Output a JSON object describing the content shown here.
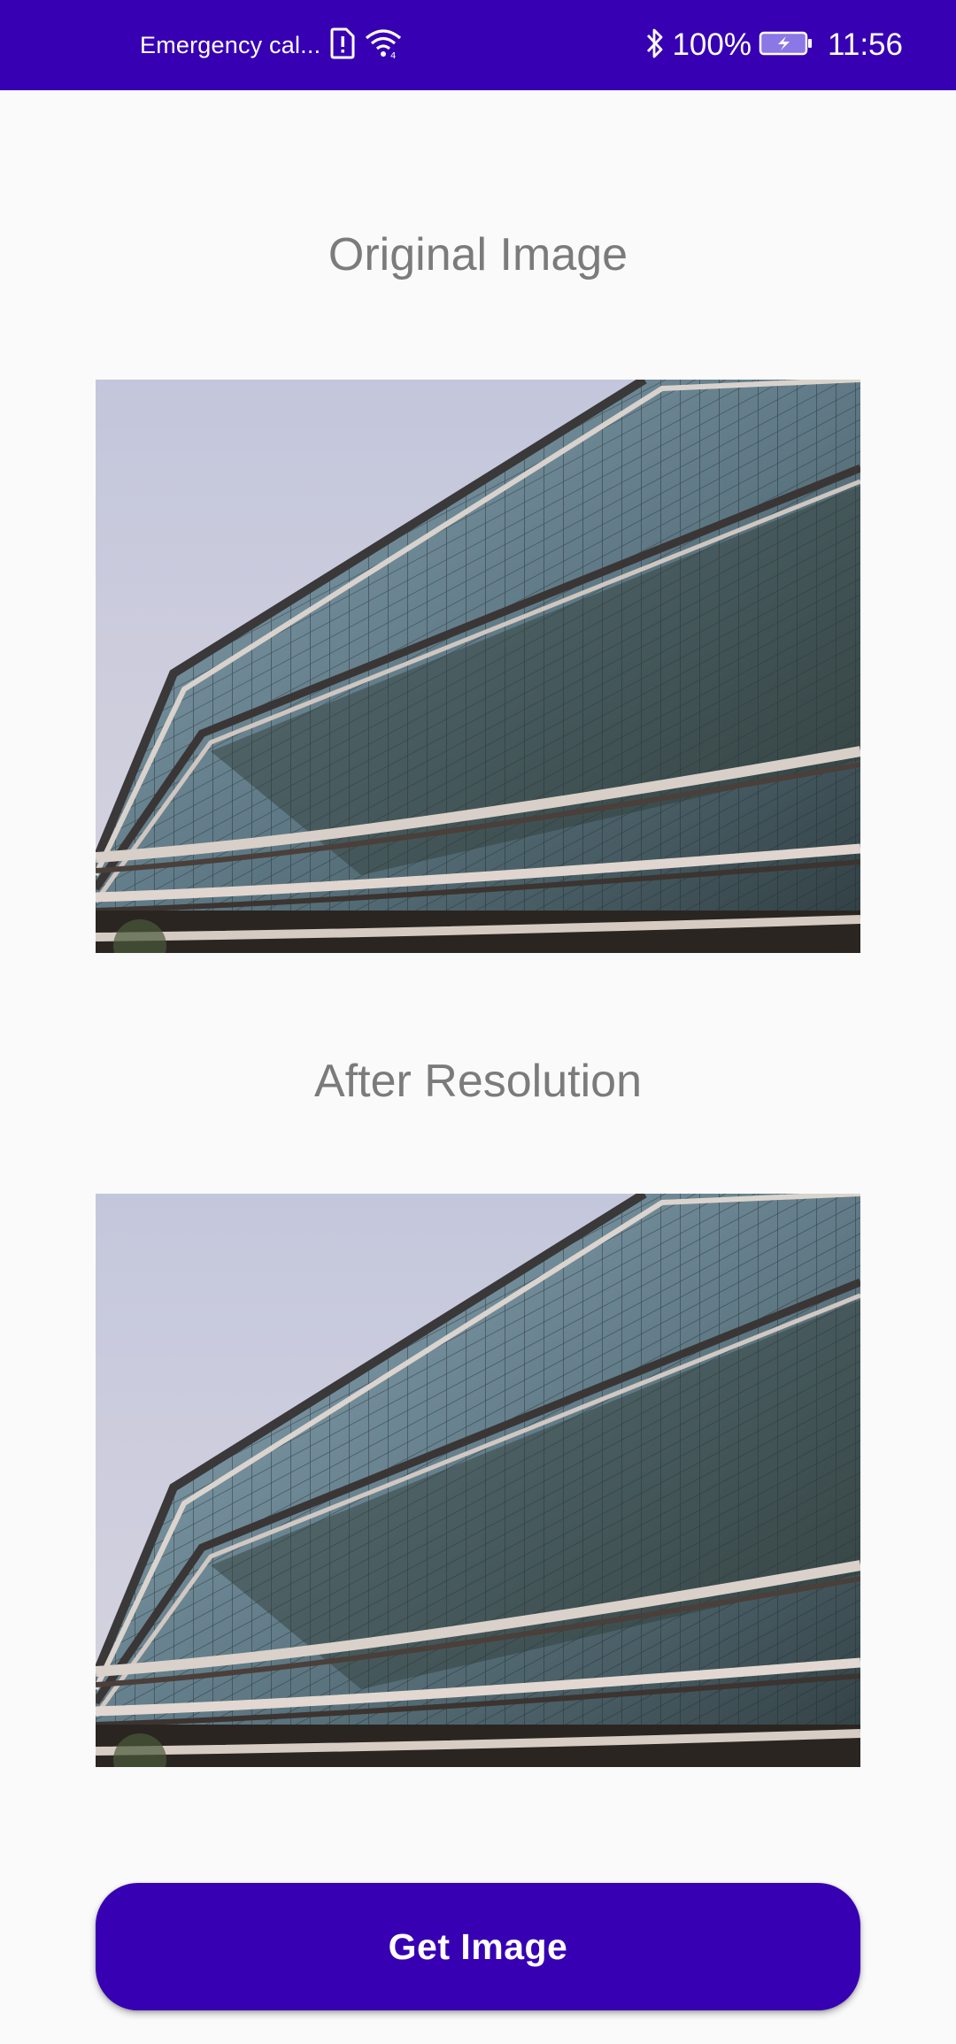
{
  "status_bar": {
    "carrier_text": "Emergency cal...",
    "battery_text": "100%",
    "time": "11:56",
    "icons": [
      "sim-alert-icon",
      "wifi-icon",
      "bluetooth-icon",
      "battery-charging-icon"
    ]
  },
  "sections": {
    "original_title": "Original Image",
    "after_title": "After Resolution"
  },
  "actions": {
    "get_image_label": "Get Image"
  },
  "colors": {
    "primary": "#3700b3",
    "title_text": "#7b7b7b",
    "background": "#fafafa"
  }
}
